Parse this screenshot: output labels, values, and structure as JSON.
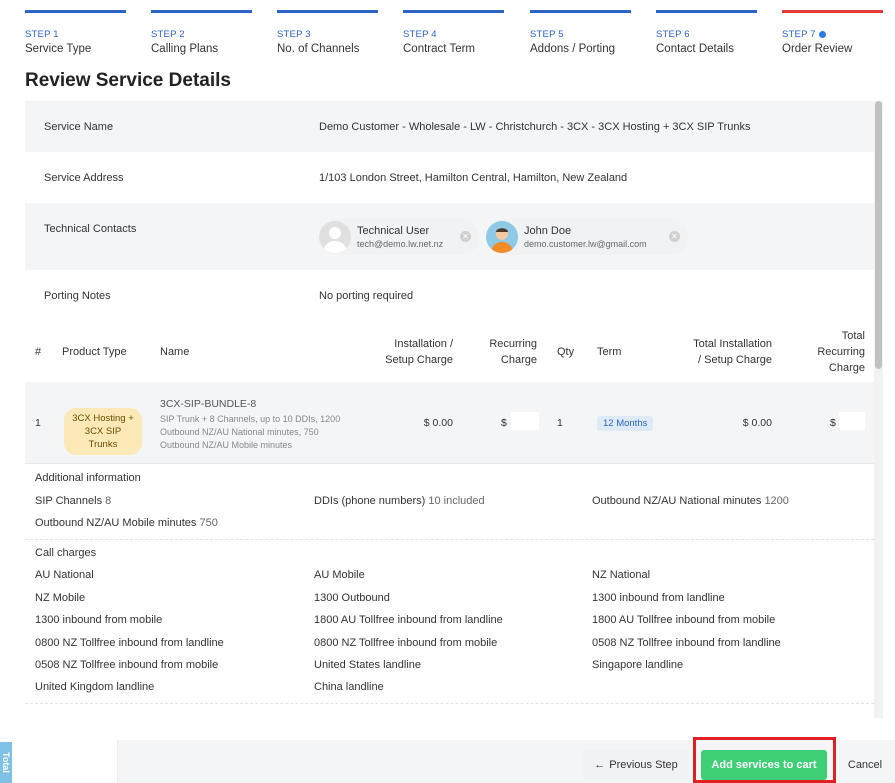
{
  "steps": [
    {
      "num": "STEP 1",
      "label": "Service Type"
    },
    {
      "num": "STEP 2",
      "label": "Calling Plans"
    },
    {
      "num": "STEP 3",
      "label": "No. of Channels"
    },
    {
      "num": "STEP 4",
      "label": "Contract Term"
    },
    {
      "num": "STEP 5",
      "label": "Addons / Porting"
    },
    {
      "num": "STEP 6",
      "label": "Contact Details"
    },
    {
      "num": "STEP 7",
      "label": "Order Review",
      "current": true
    }
  ],
  "page_title": "Review Service Details",
  "details": {
    "service_name_label": "Service Name",
    "service_name": "Demo Customer - Wholesale - LW - Christchurch - 3CX - 3CX Hosting + 3CX SIP Trunks",
    "service_address_label": "Service Address",
    "service_address": "1/103 London Street, Hamilton Central, Hamilton, New Zealand",
    "technical_contacts_label": "Technical Contacts",
    "contacts": [
      {
        "name": "Technical User",
        "email": "tech@demo.lw.net.nz"
      },
      {
        "name": "John Doe",
        "email": "demo.customer.lw@gmail.com"
      }
    ],
    "porting_notes_label": "Porting Notes",
    "porting_notes": "No porting required"
  },
  "table": {
    "headers": {
      "num": "#",
      "product_type": "Product Type",
      "name": "Name",
      "install1": "Installation /",
      "install2": "Setup Charge",
      "rec1": "Recurring",
      "rec2": "Charge",
      "qty": "Qty",
      "term": "Term",
      "tinst1": "Total Installation",
      "tinst2": "/ Setup Charge",
      "trec1": "Total",
      "trec2": "Recurring",
      "trec3": "Charge"
    },
    "row": {
      "num": "1",
      "product_type_1": "3CX Hosting +",
      "product_type_2": "3CX SIP Trunks",
      "sku": "3CX-SIP-BUNDLE-8",
      "desc1": "SIP Trunk + 8 Channels, up to 10 DDIs, 1200",
      "desc2": "Outbound NZ/AU National minutes, 750",
      "desc3": "Outbound NZ/AU Mobile minutes",
      "install": "$ 0.00",
      "recurring": "$",
      "qty": "1",
      "term": "12 Months",
      "total_install": "$ 0.00",
      "total_recurring": "$"
    }
  },
  "additional": {
    "heading": "Additional information",
    "sip_label": "SIP Channels",
    "sip_value": "8",
    "ddi_label": "DDIs (phone numbers)",
    "ddi_value": "10 included",
    "outnat_label": "Outbound NZ/AU National minutes",
    "outnat_value": "1200",
    "outmob_label": "Outbound NZ/AU Mobile minutes",
    "outmob_value": "750"
  },
  "call_charges": {
    "heading": "Call charges",
    "items": [
      "AU National",
      "AU Mobile",
      "NZ National",
      "NZ Mobile",
      "1300 Outbound",
      "1300 inbound from landline",
      "1300 inbound from mobile",
      "1800 AU Tollfree inbound from landline",
      "1800 AU Tollfree inbound from mobile",
      "0800 NZ Tollfree inbound from landline",
      "0800 NZ Tollfree inbound from mobile",
      "0508 NZ Tollfree inbound from landline",
      "0508 NZ Tollfree inbound from mobile",
      "United States landline",
      "Singapore landline",
      "United Kingdom landline",
      "China landline"
    ]
  },
  "footer": {
    "total_label": "Total",
    "prev_label": "Previous Step",
    "add_label": "Add services to cart",
    "cancel_label": "Cancel"
  }
}
